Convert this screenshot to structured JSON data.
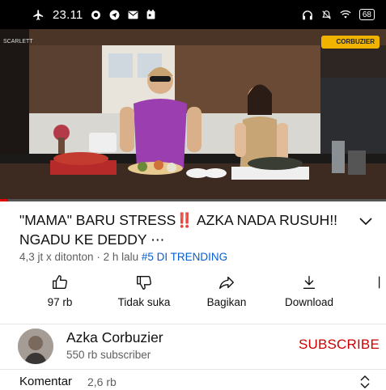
{
  "status_bar": {
    "time": "23.11",
    "battery": "68"
  },
  "video": {
    "channel_watermark": "CORBUZIER",
    "corner_watermark": "SCARLETT",
    "progress": 0.02
  },
  "video_info": {
    "title": "\"MAMA\" BARU STRESS‼️ AZKA NADA RUSUH!! NGADU KE DEDDY ⋯",
    "views": "4,3 jt x ditonton",
    "separator": " · ",
    "time_ago": "2 h lalu",
    "trending": "#5 DI TRENDING"
  },
  "actions": {
    "like": "97 rb",
    "dislike": "Tidak suka",
    "share": "Bagikan",
    "download": "Download"
  },
  "channel": {
    "name": "Azka Corbuzier",
    "subscribers": "550 rb subscriber",
    "subscribe_label": "SUBSCRIBE"
  },
  "comments": {
    "label": "Komentar",
    "count": "2,6 rb"
  },
  "colors": {
    "accent_red": "#cc0000",
    "trending_blue": "#065fd4",
    "progress_red": "#e00000"
  },
  "icons": [
    "airplane-icon",
    "whatsapp-icon",
    "telegram-icon",
    "gmail-icon",
    "calendar-icon",
    "headphones-icon",
    "mute-icon",
    "wifi-icon",
    "battery-icon",
    "chevron-down-icon",
    "like-icon",
    "dislike-icon",
    "share-icon",
    "download-icon",
    "chevron-updown-icon"
  ]
}
